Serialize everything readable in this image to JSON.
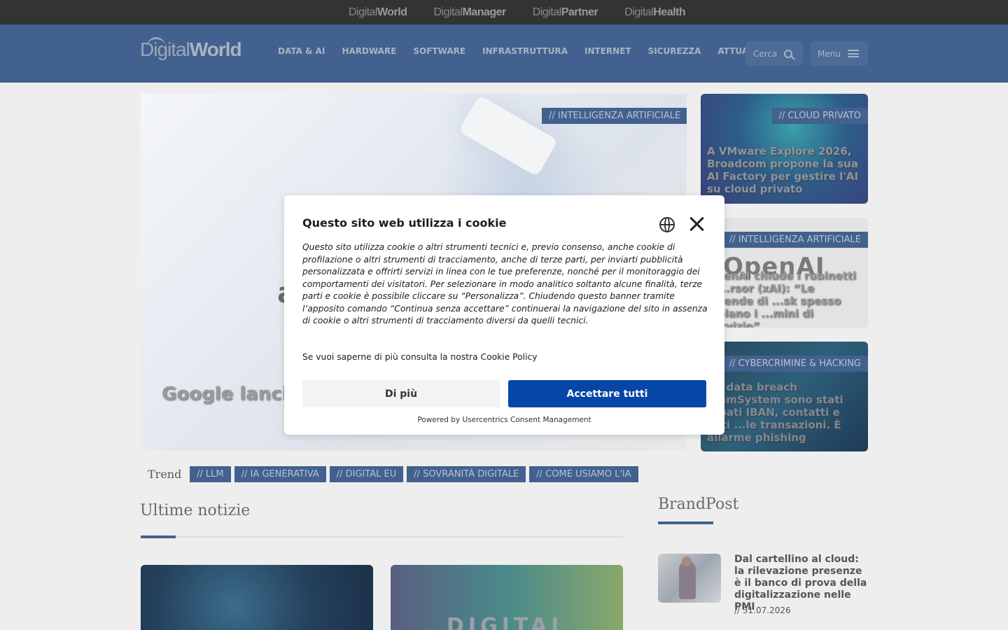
{
  "network": {
    "sites": [
      {
        "light": "Digital",
        "bold": "World"
      },
      {
        "light": "Digital",
        "bold": "Manager"
      },
      {
        "light": "Digital",
        "bold": "Partner"
      },
      {
        "light": "Digital",
        "bold": "Health"
      }
    ]
  },
  "header": {
    "logo_light": "Digital",
    "logo_bold": "World",
    "nav": [
      "DATA & AI",
      "HARDWARE",
      "SOFTWARE",
      "INFRASTRUTTURA",
      "INTERNET",
      "SICUREZZA",
      "ATTUALITÀ"
    ],
    "search_label": "Cerca",
    "menu_label": "Menu"
  },
  "hero": {
    "tag": "// INTELLIGENZA ARTIFICIALE",
    "title": "Google lancia ... Cyber per go...",
    "image_letter": "a"
  },
  "side_cards": [
    {
      "tag": "// CLOUD PRIVATO",
      "title": "A VMware Explore 2026, Broadcom propone la sua AI Factory per gestire l'AI su cloud privato"
    },
    {
      "tag": "// INTELLIGENZA ARTIFICIALE",
      "title": "OpenAI chiude i rubinetti a ...rsor (xAI): “Le aziende di ...sk spesso violano i ...mini di servizio”",
      "logo": "OpenAI"
    },
    {
      "tag": "// CYBERCRIMINE & HACKING",
      "title": "...l data breach ...amSystem sono stati ...bati IBAN, contatti e dati ...le transazioni. È allarme phishing"
    }
  ],
  "trend": {
    "label": "Trend",
    "tags": [
      "// LLM",
      "// IA GENERATIVA",
      "// DIGITAL EU",
      "// SOVRANITÀ DIGITALE",
      "// COME USIAMO L'IA"
    ]
  },
  "news": {
    "title": "Ultime notizie",
    "card2_text": "DIGITAL"
  },
  "brandpost": {
    "title": "BrandPost",
    "headline": "Dal cartellino al cloud: la rilevazione presenze è il banco di prova della digitalizzazione nelle PMI",
    "date": "// 31.07.2026"
  },
  "cookie": {
    "title": "Questo sito web utilizza i cookie",
    "body": "Questo sito utilizza cookie o altri strumenti tecnici e, previo consenso, anche cookie di profilazione o altri strumenti di tracciamento, anche di terze parti, per inviarti pubblicità personalizzata e offrirti servizi in linea con le tue preferenze, nonché per il monitoraggio dei comportamenti dei visitatori. Per selezionare in modo analitico soltanto alcune finalità, terze parti e cookie è possibile cliccare su “Personalizza”. Chiudendo questo banner tramite l’apposito comando “Continua senza accettare” continuerai la navigazione del sito in assenza di cookie o altri strumenti di tracciamento diversi da quelli tecnici.",
    "policy": "Se vuoi saperne di più consulta la nostra Cookie Policy",
    "more_label": "Di più",
    "accept_label": "Accettare tutti",
    "powered": "Powered by Usercentrics Consent Management"
  },
  "colors": {
    "brand": "#42618e",
    "accept": "#0745a6"
  }
}
